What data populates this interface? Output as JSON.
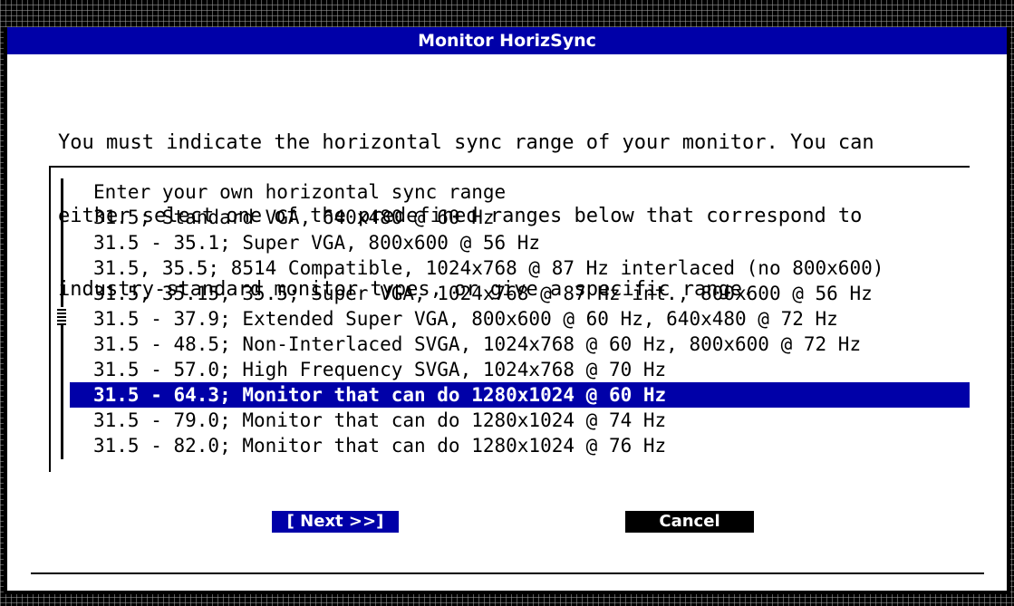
{
  "dialog": {
    "title": "Monitor HorizSync",
    "description_lines": [
      "You must indicate the horizontal sync range of your monitor. You can",
      "either select one of the predefined ranges below that correspond to",
      "industry-standard monitor types, or give a specific range."
    ]
  },
  "list": {
    "options": [
      "Enter your own horizontal sync range",
      "31.5; Standard VGA, 640x480 @ 60 Hz",
      "31.5 - 35.1; Super VGA, 800x600 @ 56 Hz",
      "31.5, 35.5; 8514 Compatible, 1024x768 @ 87 Hz interlaced (no 800x600)",
      "31.5, 35.15, 35.5; Super VGA, 1024x768 @ 87 Hz int., 800x600 @ 56 Hz",
      "31.5 - 37.9; Extended Super VGA, 800x600 @ 60 Hz, 640x480 @ 72 Hz",
      "31.5 - 48.5; Non-Interlaced SVGA, 1024x768 @ 60 Hz, 800x600 @ 72 Hz",
      "31.5 - 57.0; High Frequency SVGA, 1024x768 @ 70 Hz",
      "31.5 - 64.3; Monitor that can do 1280x1024 @ 60 Hz",
      "31.5 - 79.0; Monitor that can do 1280x1024 @ 74 Hz",
      "31.5 - 82.0; Monitor that can do 1280x1024 @ 76 Hz"
    ],
    "selected_index": 8
  },
  "buttons": {
    "next_label": "[ Next >>]",
    "cancel_label": "Cancel"
  },
  "colors": {
    "titlebar": "#0000a8",
    "selection": "#0000a8",
    "background": "#ffffff"
  }
}
